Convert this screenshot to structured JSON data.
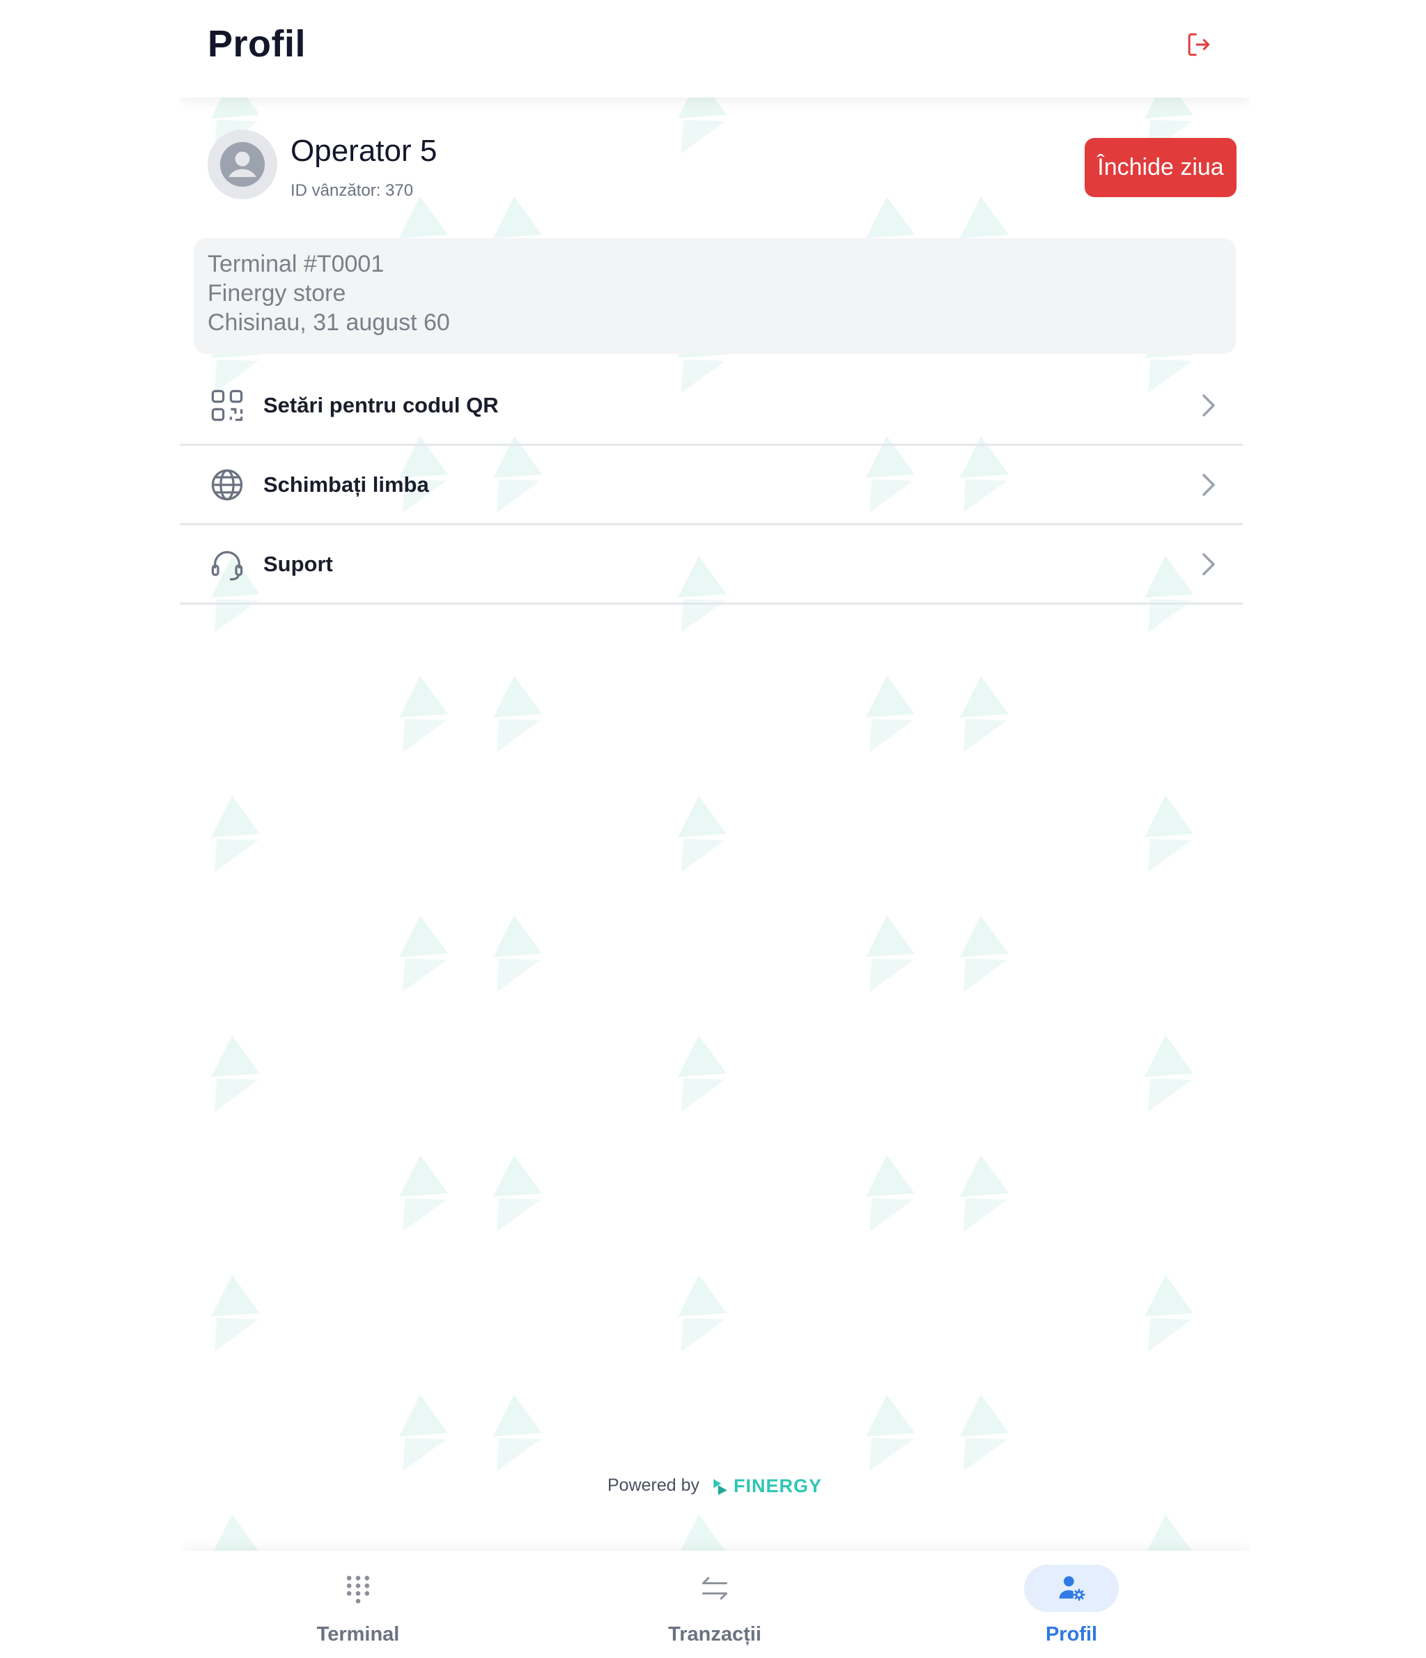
{
  "header": {
    "title": "Profil",
    "logout_icon": "logout-icon"
  },
  "profile": {
    "operator_name": "Operator 5",
    "seller_id": "ID vânzător: 370",
    "close_day_label": "Închide ziua",
    "avatar_icon": "user-avatar-icon"
  },
  "terminal": {
    "id": "Terminal #T0001",
    "store": "Finergy store",
    "address": "Chisinau, 31 august 60"
  },
  "menu": {
    "items": [
      {
        "label": "Setări pentru codul QR",
        "icon": "qr-code-icon"
      },
      {
        "label": "Schimbați limba",
        "icon": "globe-icon"
      },
      {
        "label": "Suport",
        "icon": "headset-icon"
      }
    ]
  },
  "footer": {
    "powered_by": "Powered by",
    "brand": "FINERGY"
  },
  "nav": {
    "items": [
      {
        "label": "Terminal",
        "icon": "keypad-icon",
        "active": false
      },
      {
        "label": "Tranzacții",
        "icon": "transfer-arrows-icon",
        "active": false
      },
      {
        "label": "Profil",
        "icon": "user-settings-icon",
        "active": true
      }
    ]
  },
  "colors": {
    "accent": "#2f7ae5",
    "danger": "#e23b3b",
    "brand": "#2fc6b3",
    "nav_active_bg": "#e4eefc"
  }
}
